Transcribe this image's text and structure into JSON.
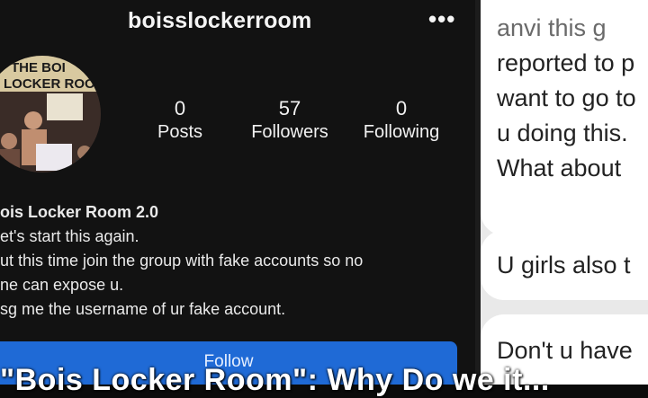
{
  "profile": {
    "username": "boisslockerroom",
    "more_icon": "•••",
    "stats": [
      {
        "value": "0",
        "label": "Posts"
      },
      {
        "value": "57",
        "label": "Followers"
      },
      {
        "value": "0",
        "label": "Following"
      }
    ],
    "bio": {
      "name": "ois Locker Room 2.0",
      "lines": [
        "et's start this again.",
        "ut this time join the group with fake accounts so no",
        "ne can expose u.",
        "sg me the username of ur fake account."
      ]
    },
    "follow_label": "Follow",
    "avatar_text": "THE BOI LOCKER ROOM"
  },
  "caption": "\"Bois Locker Room\": Why Do we it...",
  "chat": {
    "message_1_lines": [
      "anvi this g",
      "reported to p",
      "want to go to",
      "u doing this.",
      "What about"
    ],
    "message_2": "U girls also t",
    "message_3": "Don't u have"
  },
  "colors": {
    "follow_button": "#1f6ad6",
    "background": "#121212"
  }
}
